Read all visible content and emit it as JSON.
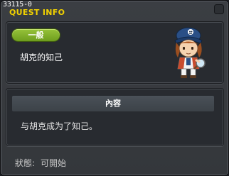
{
  "window": {
    "quest_id": "33115-0",
    "title": "QUEST INFO",
    "close_icon": "close-icon"
  },
  "quest": {
    "category": "一般",
    "name": "胡克的知己",
    "npc_icon": "npc-portrait-icon"
  },
  "content": {
    "header": "內容",
    "text": "与胡克成为了知己。"
  },
  "status": {
    "label": "狀態:",
    "value": "可開始"
  },
  "colors": {
    "title": "#f2d200",
    "badge": "#85b22c",
    "panel": "#282b30",
    "window": "#3b3e43"
  }
}
